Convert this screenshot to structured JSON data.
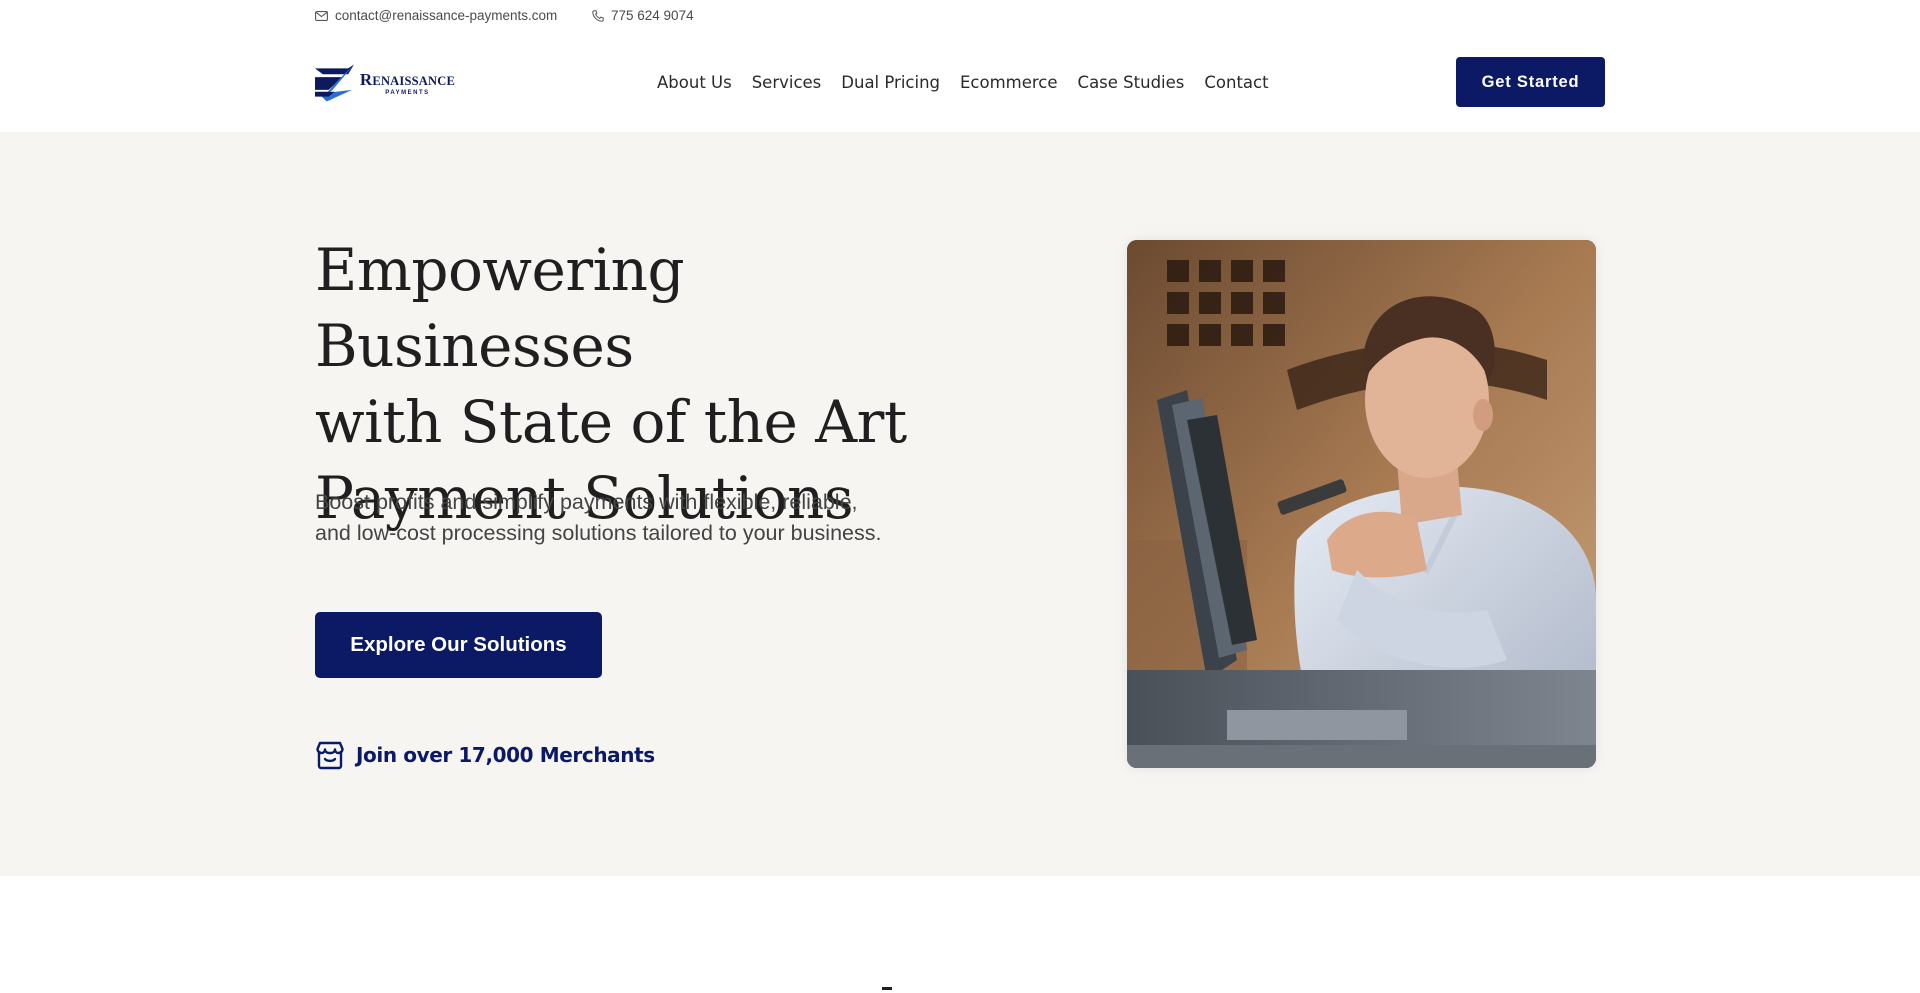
{
  "topbar": {
    "email": "contact@renaissance-payments.com",
    "phone": "775 624 9074",
    "icons": {
      "email": "mail-icon",
      "phone": "phone-icon"
    }
  },
  "header": {
    "logo": {
      "word_first": "R",
      "word_rest": "ENAISSANCE",
      "sub": "PAYMENTS"
    },
    "nav": [
      "About Us",
      "Services",
      "Dual Pricing",
      "Ecommerce",
      "Case Studies",
      "Contact"
    ],
    "cta": "Get Started"
  },
  "hero": {
    "title_lines": [
      "Empowering Businesses",
      "with State of the Art",
      "Payment Solutions"
    ],
    "lead_lines": [
      "Boost profits and simplify payments with flexible, reliable,",
      "and low-cost processing solutions tailored to your business."
    ],
    "button": "Explore Our Solutions",
    "merchants": "Join over 17,000 Merchants",
    "merchants_icon": "storefront-icon",
    "image": "man-at-pos-terminal-photo"
  },
  "colors": {
    "brand_navy": "#0c1a66",
    "hero_bg": "#f6f5f2",
    "logo_blue": "#2a6fd6"
  }
}
